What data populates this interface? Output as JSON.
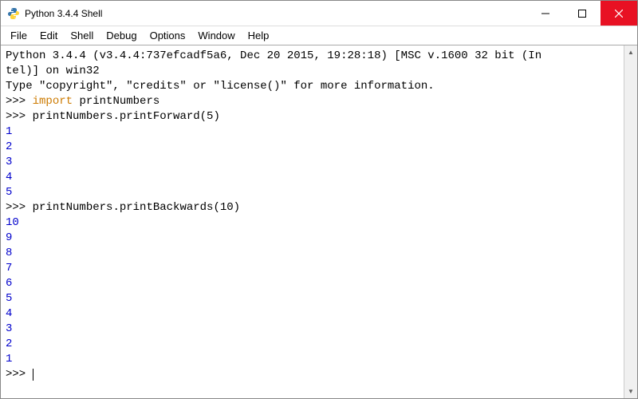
{
  "titlebar": {
    "title": "Python 3.4.4 Shell"
  },
  "menubar": {
    "items": [
      "File",
      "Edit",
      "Shell",
      "Debug",
      "Options",
      "Window",
      "Help"
    ]
  },
  "console": {
    "banner1": "Python 3.4.4 (v3.4.4:737efcadf5a6, Dec 20 2015, 19:28:18) [MSC v.1600 32 bit (In",
    "banner2": "tel)] on win32",
    "banner3": "Type \"copyright\", \"credits\" or \"license()\" for more information.",
    "prompt": ">>>",
    "import_kw": "import",
    "import_mod": " printNumbers",
    "call1": "printNumbers.printForward(5)",
    "out1": [
      "1",
      "2",
      "3",
      "4",
      "5"
    ],
    "call2": "printNumbers.printBackwards(10)",
    "out2": [
      "10",
      "9",
      "8",
      "7",
      "6",
      "5",
      "4",
      "3",
      "2",
      "1"
    ]
  }
}
